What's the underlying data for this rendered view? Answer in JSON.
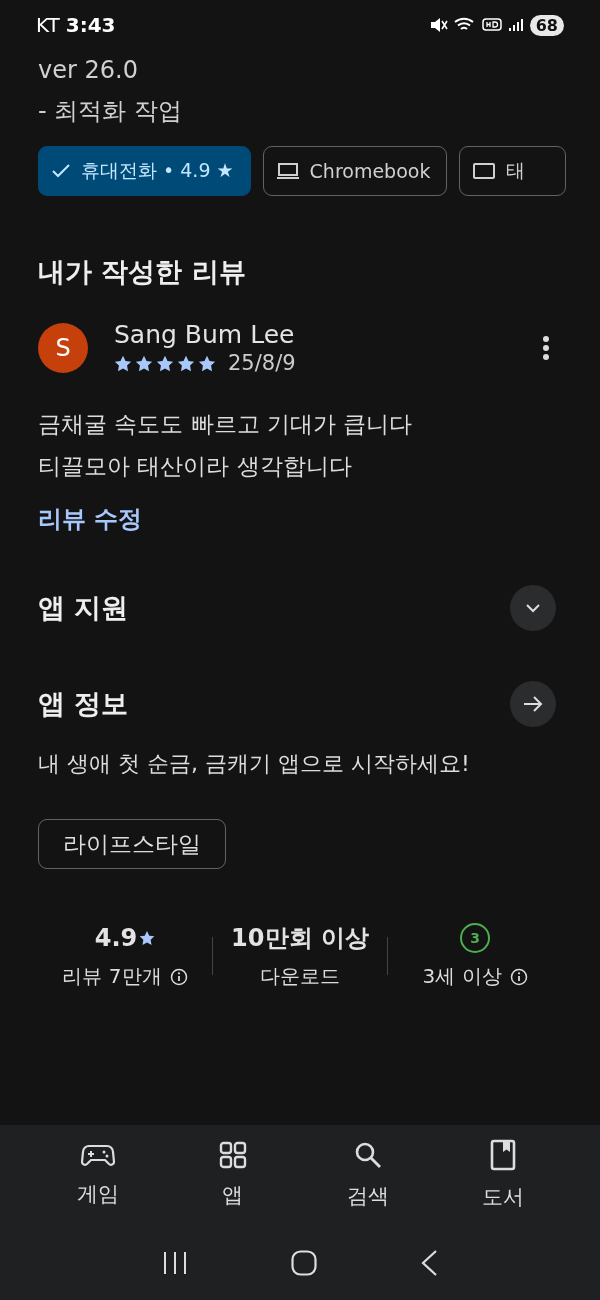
{
  "status_bar": {
    "carrier": "KT",
    "time": "3:43",
    "battery": "68"
  },
  "whats_new": [
    "ver 26.0",
    "- 최적화 작업"
  ],
  "devices": [
    {
      "kind": "check",
      "label": "휴대전화 • 4.9 ★",
      "selected": true
    },
    {
      "kind": "laptop",
      "label": "Chromebook",
      "selected": false
    },
    {
      "kind": "tablet",
      "label": "태",
      "selected": false
    }
  ],
  "my_review": {
    "heading": "내가 작성한 리뷰",
    "avatar": "S",
    "author": "Sang Bum Lee",
    "stars": 5,
    "date": "25/8/9",
    "text": [
      "금채굴 속도도 빠르고 기대가 큽니다",
      "티끌모아 태산이라 생각합니다"
    ],
    "edit_link": "리뷰 수정"
  },
  "sections": [
    {
      "kind": "expand",
      "title": "앱 지원"
    },
    {
      "kind": "arrow",
      "title": "앱 정보"
    }
  ],
  "description": "내 생애 첫 순금, 금캐기 앱으로 시작하세요!",
  "category_tag": "라이프스타일",
  "stats": [
    {
      "kind": "rating",
      "value": "4.9",
      "label": "리뷰 7만개",
      "info": true
    },
    {
      "kind": "text",
      "value": "10만회 이상",
      "label": "다운로드",
      "info": false
    },
    {
      "kind": "age",
      "value": "3",
      "label": "3세 이상",
      "info": true
    }
  ],
  "bottom_nav": [
    {
      "kind": "game",
      "label": "게임"
    },
    {
      "kind": "apps",
      "label": "앱"
    },
    {
      "kind": "search",
      "label": "검색"
    },
    {
      "kind": "book",
      "label": "도서"
    }
  ]
}
